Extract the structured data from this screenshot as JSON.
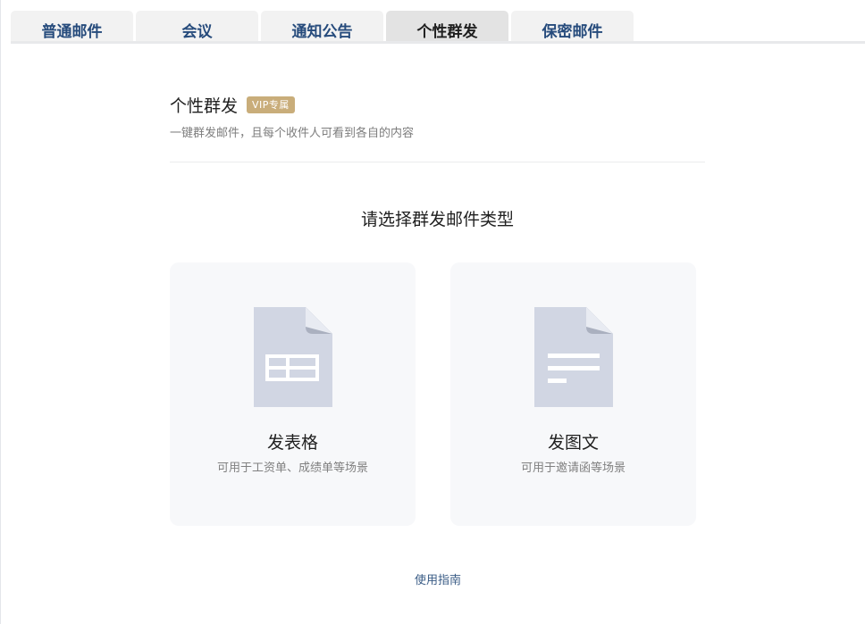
{
  "tabs": [
    {
      "label": "普通邮件",
      "active": false
    },
    {
      "label": "会议",
      "active": false
    },
    {
      "label": "通知公告",
      "active": false
    },
    {
      "label": "个性群发",
      "active": true
    },
    {
      "label": "保密邮件",
      "active": false
    }
  ],
  "header": {
    "title": "个性群发",
    "badge": "VIP专属",
    "subtitle": "一键群发邮件，且每个收件人可看到各自的内容"
  },
  "prompt": "请选择群发邮件类型",
  "cards": [
    {
      "icon": "spreadsheet-doc-icon",
      "title": "发表格",
      "desc": "可用于工资单、成绩单等场景"
    },
    {
      "icon": "text-doc-icon",
      "title": "发图文",
      "desc": "可用于邀请函等场景"
    }
  ],
  "guide_link": "使用指南",
  "colors": {
    "tab_text": "#264b7c",
    "badge_bg": "#c9ad7a",
    "card_bg": "#f7f8fa",
    "doc_icon": "#d1d6e3",
    "link": "#3a5c86"
  }
}
